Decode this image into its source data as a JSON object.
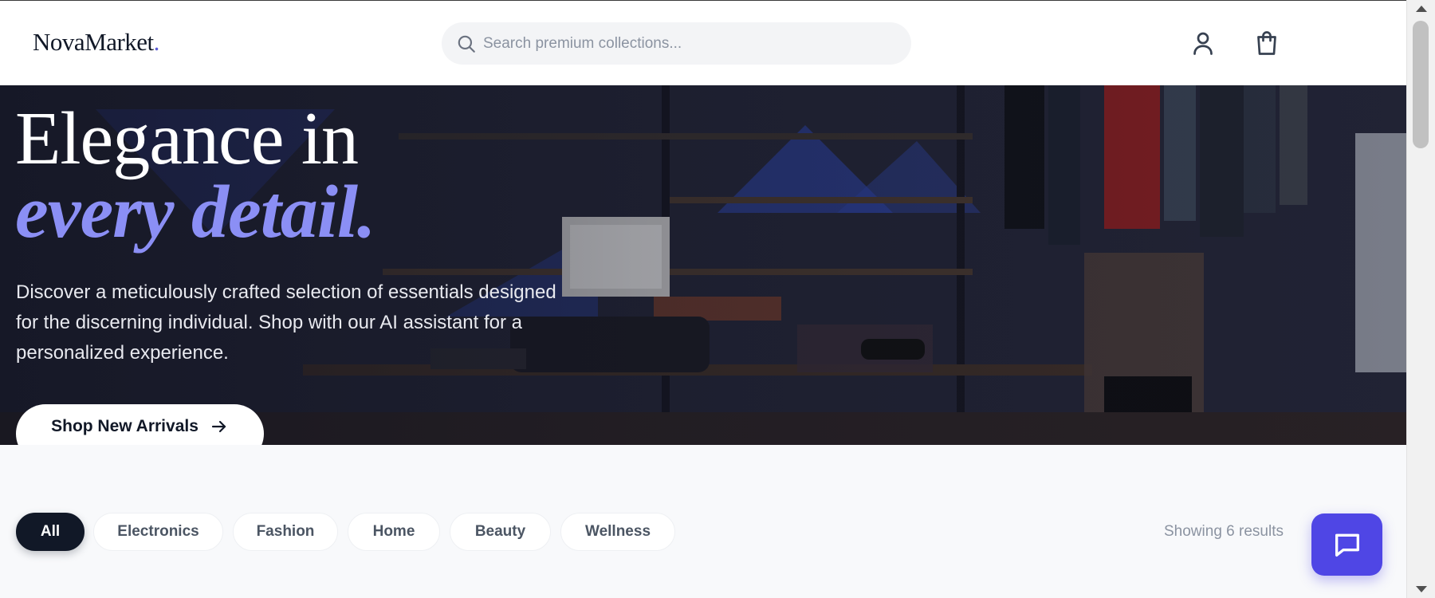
{
  "header": {
    "brand_name": "NovaMarket",
    "brand_dot": ".",
    "search_placeholder": "Search premium collections...",
    "icons": [
      "search-icon",
      "user-icon",
      "shopping-bag-icon"
    ]
  },
  "hero": {
    "title_line1": "Elegance in",
    "title_line2": "every detail.",
    "subtitle": "Discover a meticulously crafted selection of essentials designed for the discerning individual. Shop with our AI assistant for a personalized experience.",
    "cta_label": "Shop New Arrivals",
    "cta_icon": "arrow-right-icon"
  },
  "filters": {
    "categories": [
      "All",
      "Electronics",
      "Fashion",
      "Home",
      "Beauty",
      "Wellness"
    ],
    "active": "All",
    "results_text": "Showing 6 results"
  },
  "chat": {
    "icon": "chat-bubble-icon"
  },
  "colors": {
    "accent": "#4f46e5",
    "accent_text": "#8b8ff5",
    "dark": "#111827",
    "muted": "#8b93a1"
  }
}
